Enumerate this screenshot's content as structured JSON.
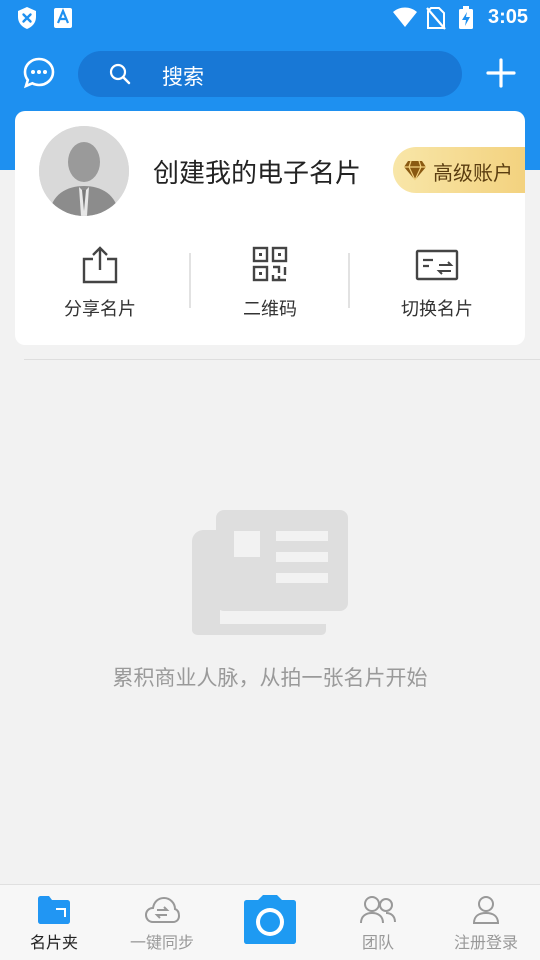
{
  "status_bar": {
    "time": "3:05",
    "icons": [
      "shield-x-icon",
      "text-a-icon",
      "wifi-icon",
      "no-sim-icon",
      "battery-charging-icon"
    ]
  },
  "header": {
    "search_placeholder": "搜索",
    "left_icon": "chat-bubble-icon",
    "right_icon": "plus-icon"
  },
  "profile_card": {
    "title": "创建我的电子名片",
    "premium_label": "高级账户",
    "actions": [
      {
        "label": "分享名片",
        "icon": "share-icon"
      },
      {
        "label": "二维码",
        "icon": "qr-code-icon"
      },
      {
        "label": "切换名片",
        "icon": "switch-card-icon"
      }
    ]
  },
  "empty_state": {
    "message": "累积商业人脉，从拍一张名片开始"
  },
  "bottom_nav": {
    "items": [
      {
        "label": "名片夹",
        "icon": "folder-icon",
        "active": true
      },
      {
        "label": "一键同步",
        "icon": "cloud-sync-icon",
        "active": false
      },
      {
        "label": "",
        "icon": "camera-icon",
        "active": false
      },
      {
        "label": "团队",
        "icon": "team-icon",
        "active": false
      },
      {
        "label": "注册登录",
        "icon": "user-icon",
        "active": false
      }
    ]
  },
  "colors": {
    "brand_blue": "#1e90f0",
    "search_bg": "#1878d6",
    "premium_gold": "#f3d27f",
    "nav_active": "#2196f3"
  }
}
